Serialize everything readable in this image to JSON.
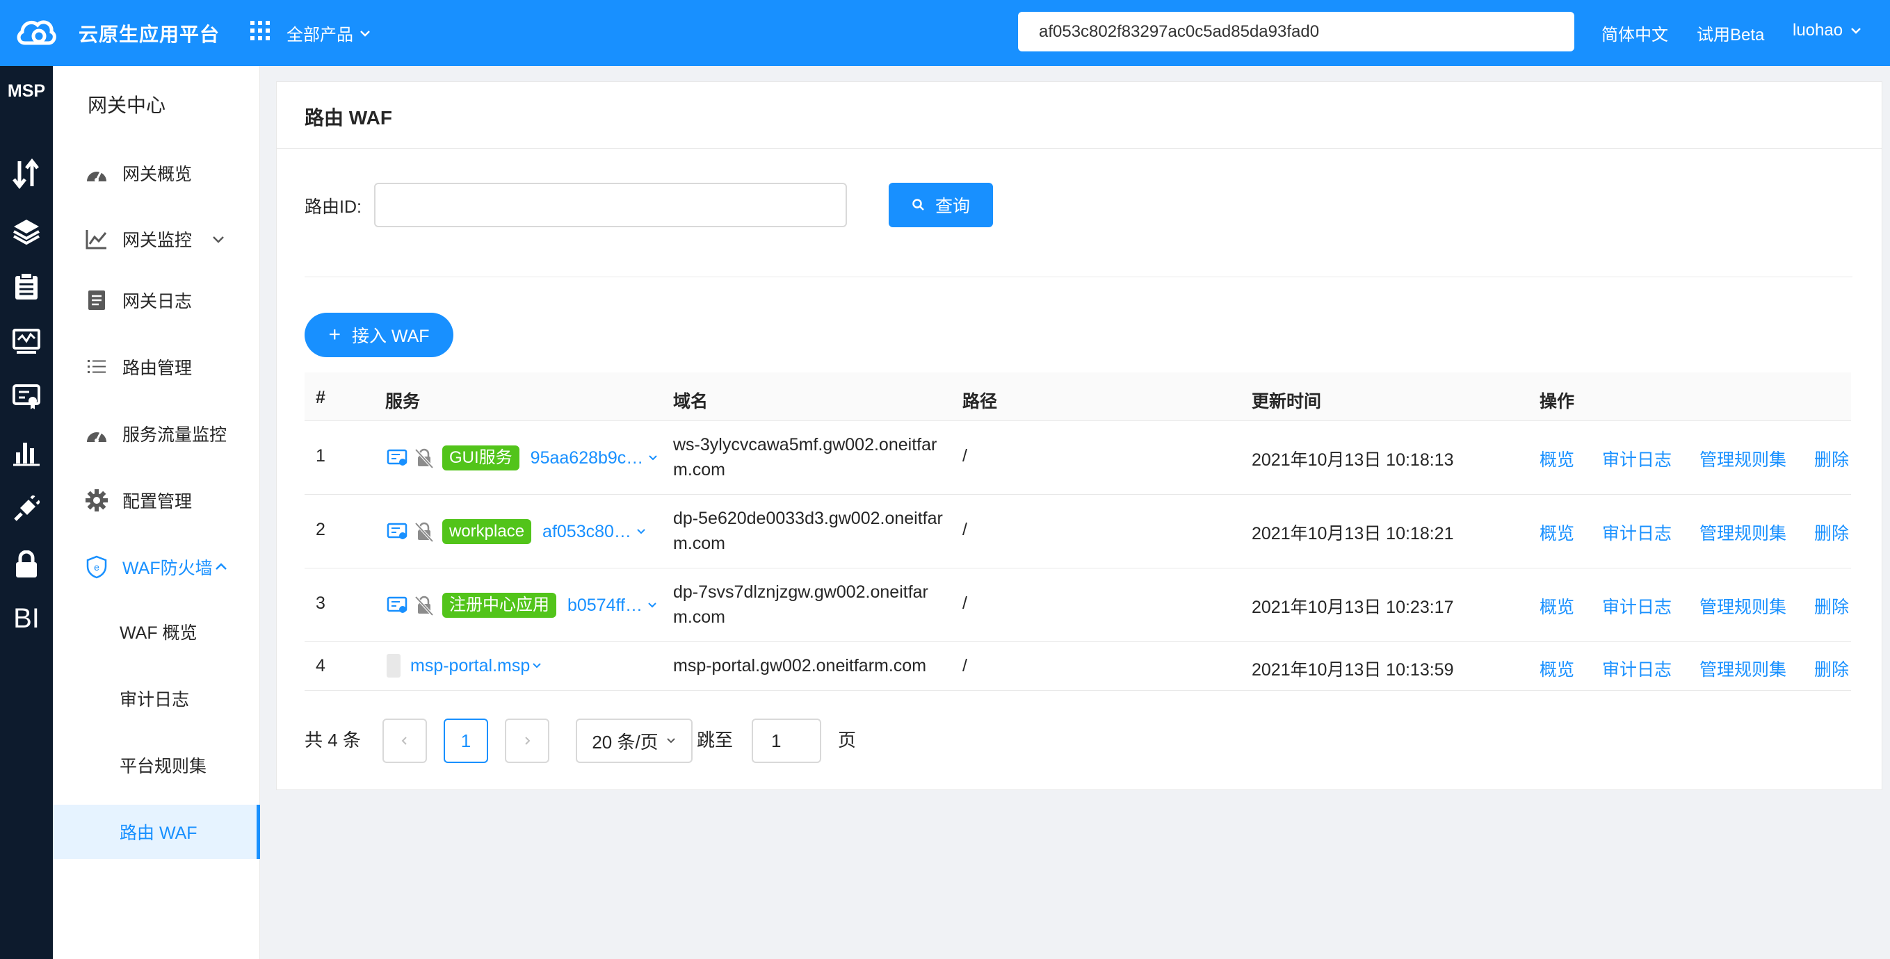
{
  "header": {
    "app_title": "云原生应用平台",
    "products_label": "全部产品",
    "search_value": "af053c802f83297ac0c5ad85da93fad0",
    "lang_label": "简体中文",
    "beta_label": "试用Beta",
    "user_label": "luohao",
    "accent_color": "#1890ff"
  },
  "rail": {
    "brand": "MSP",
    "bi_label": "BI",
    "icons": [
      "transfer-icon",
      "layers-icon",
      "clipboard-icon",
      "monitor-icon",
      "certificate-icon",
      "bar-chart-icon",
      "plug-icon",
      "lock-icon"
    ]
  },
  "sidebar": {
    "title": "网关中心",
    "items": [
      {
        "label": "网关概览",
        "icon": "dashboard-icon"
      },
      {
        "label": "网关监控",
        "icon": "line-chart-icon"
      },
      {
        "label": "网关日志",
        "icon": "file-icon"
      },
      {
        "label": "路由管理",
        "icon": "list-icon"
      },
      {
        "label": "服务流量监控",
        "icon": "dashboard-icon"
      },
      {
        "label": "配置管理",
        "icon": "gear-icon"
      },
      {
        "label": "WAF防火墙",
        "icon": "shield-icon"
      }
    ],
    "sub_items": [
      {
        "label": "WAF 概览"
      },
      {
        "label": "审计日志"
      },
      {
        "label": "平台规则集"
      },
      {
        "label": "路由 WAF"
      }
    ]
  },
  "page": {
    "title": "路由 WAF",
    "route_id_label": "路由ID:",
    "route_id_value": "",
    "query_label": "查询",
    "add_label": "接入 WAF"
  },
  "table": {
    "columns": [
      "#",
      "服务",
      "域名",
      "路径",
      "更新时间",
      "操作"
    ],
    "rows": [
      {
        "index": "1",
        "tag": "GUI服务",
        "service": "95aa628b9c…",
        "domain": "ws-3ylycvcawa5mf.gw002.oneitfarm.com",
        "path": "/",
        "updated": "2021年10月13日 10:18:13"
      },
      {
        "index": "2",
        "tag": "workplace",
        "service": "af053c80…",
        "domain": "dp-5e620de0033d3.gw002.oneitfarm.com",
        "path": "/",
        "updated": "2021年10月13日 10:18:21"
      },
      {
        "index": "3",
        "tag": "注册中心应用",
        "service": "b0574ff…",
        "domain": "dp-7svs7dlznjzgw.gw002.oneitfarm.com",
        "path": "/",
        "updated": "2021年10月13日 10:23:17"
      },
      {
        "index": "4",
        "tag": "",
        "service": "msp-portal.msp",
        "domain": "msp-portal.gw002.oneitfarm.com",
        "path": "/",
        "updated": "2021年10月13日 10:13:59"
      }
    ],
    "actions": [
      "概览",
      "审计日志",
      "管理规则集",
      "删除"
    ]
  },
  "pagination": {
    "total_label": "共 4 条",
    "current_page": "1",
    "page_size_label": "20 条/页",
    "jump_label": "跳至",
    "jump_value": "1",
    "page_suffix": "页"
  }
}
